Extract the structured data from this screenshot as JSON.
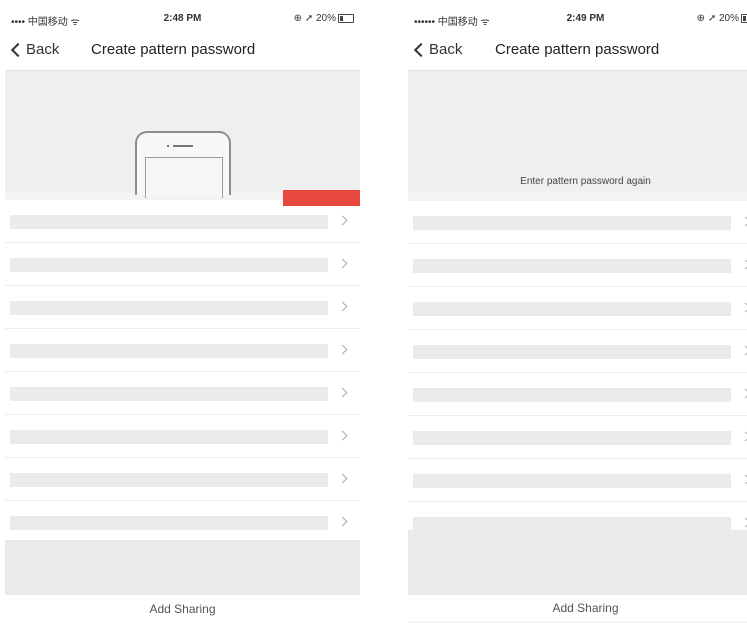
{
  "screens": [
    {
      "status_bar": {
        "carrier": "•••• 中国移动 ᯤ",
        "time": "2:48 PM",
        "right": "⊕ ➚ 20%"
      },
      "nav": {
        "back_label": "Back",
        "title": "Create pattern password"
      },
      "hint": "",
      "list_items": 8,
      "footer_label": "Add Sharing"
    },
    {
      "status_bar": {
        "carrier": "•••••• 中国移动 ᯤ",
        "time": "2:49 PM",
        "right": "⊕ ➚ 20%"
      },
      "nav": {
        "back_label": "Back",
        "title": "Create pattern password"
      },
      "hint": "Enter pattern password again",
      "list_items": 8,
      "footer_label": "Add Sharing"
    }
  ],
  "colors": {
    "accent_red": "#e8473e",
    "panel_gray": "#efefef",
    "row_placeholder": "#ebebeb"
  },
  "icons": [
    "chevron-left-icon",
    "chevron-right-icon",
    "battery-icon",
    "phone-outline-icon"
  ]
}
